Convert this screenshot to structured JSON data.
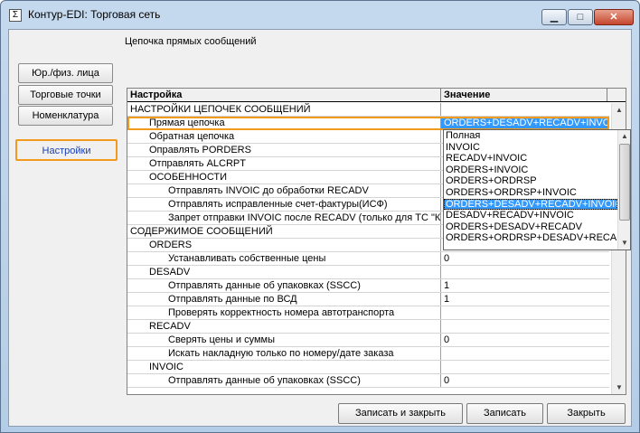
{
  "window": {
    "title": "Контур-EDI: Торговая сеть",
    "app_icon": "Σ",
    "min_glyph": "▁",
    "max_glyph": "□",
    "close_glyph": "✕"
  },
  "section_label": "Цепочка прямых сообщений",
  "sidebar": {
    "items": [
      {
        "label": "Юр./физ. лица"
      },
      {
        "label": "Торговые точки"
      },
      {
        "label": "Номенклатура"
      },
      {
        "label": "Настройки"
      }
    ]
  },
  "grid": {
    "headers": {
      "name": "Настройка",
      "value": "Значение"
    },
    "rows": [
      {
        "name": "НАСТРОЙКИ ЦЕПОЧЕК СООБЩЕНИЙ",
        "indent": 0,
        "value": ""
      },
      {
        "name": "Прямая цепочка",
        "indent": 1,
        "value": "ORDERS+DESADV+RECADV+INVOI"
      },
      {
        "name": "Обратная цепочка",
        "indent": 1,
        "value": ""
      },
      {
        "name": "Оправлять PORDERS",
        "indent": 1,
        "value": ""
      },
      {
        "name": "Отправлять ALCRPT",
        "indent": 1,
        "value": ""
      },
      {
        "name": "ОСОБЕННОСТИ",
        "indent": 1,
        "value": ""
      },
      {
        "name": "Отправлять INVOIC до обработки RECADV",
        "indent": 2,
        "value": ""
      },
      {
        "name": "Отправлять исправленные счет-фактуры(ИСФ)",
        "indent": 2,
        "value": ""
      },
      {
        "name": "Запрет отправки INVOIC после RECADV (только для ТС \"К",
        "indent": 2,
        "value": ""
      },
      {
        "name": "СОДЕРЖИМОЕ СООБЩЕНИЙ",
        "indent": 0,
        "value": ""
      },
      {
        "name": "ORDERS",
        "indent": 1,
        "value": ""
      },
      {
        "name": "Устанавливать собственные цены",
        "indent": 2,
        "value": "0"
      },
      {
        "name": "DESADV",
        "indent": 1,
        "value": ""
      },
      {
        "name": "Отправлять данные об упаковках (SSCC)",
        "indent": 2,
        "value": "1"
      },
      {
        "name": "Отправлять данные по ВСД",
        "indent": 2,
        "value": "1"
      },
      {
        "name": "Проверять корректность номера автотранспорта",
        "indent": 2,
        "value": ""
      },
      {
        "name": "RECADV",
        "indent": 1,
        "value": ""
      },
      {
        "name": "Сверять цены и суммы",
        "indent": 2,
        "value": "0"
      },
      {
        "name": "Искать накладную только по номеру/дате заказа",
        "indent": 2,
        "value": ""
      },
      {
        "name": "INVOIC",
        "indent": 1,
        "value": ""
      },
      {
        "name": "Отправлять данные об упаковках (SSCC)",
        "indent": 2,
        "value": "0"
      }
    ],
    "selected_row": 1
  },
  "dropdown": {
    "options": [
      "Полная",
      "INVOIC",
      "RECADV+INVOIC",
      "ORDERS+INVOIC",
      "ORDERS+ORDRSP",
      "ORDERS+ORDRSP+INVOIC",
      "ORDERS+DESADV+RECADV+INVOIC",
      "DESADV+RECADV+INVOIC",
      "ORDERS+DESADV+RECADV",
      "ORDERS+ORDRSP+DESADV+RECAD"
    ],
    "selected_index": 6
  },
  "buttons": {
    "save_close": "Записать и закрыть",
    "save": "Записать",
    "close": "Закрыть"
  },
  "icons": {
    "scroll_up": "▲",
    "scroll_down": "▼"
  }
}
